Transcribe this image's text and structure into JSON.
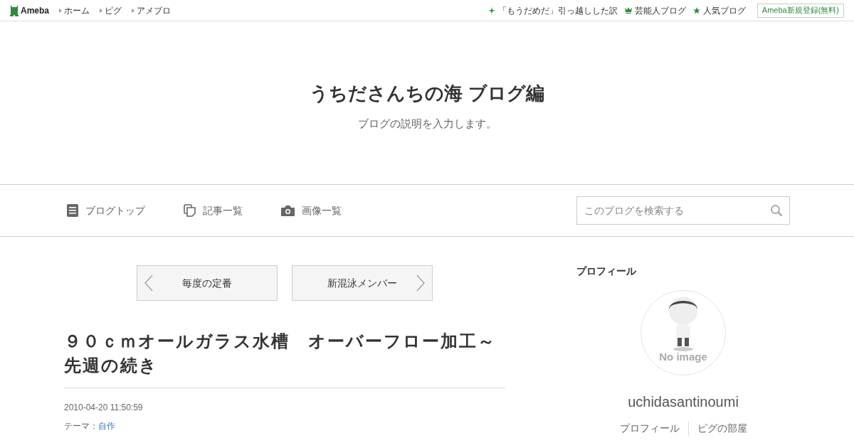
{
  "topbar": {
    "logo": "Ameba",
    "links": [
      "ホーム",
      "ピグ",
      "アメブロ"
    ],
    "right_links": [
      {
        "kind": "sparkle",
        "label": "「もうだめだ」引っ越しした訳"
      },
      {
        "kind": "crown",
        "label": "芸能人ブログ"
      },
      {
        "kind": "star",
        "label": "人気ブログ"
      }
    ],
    "signup": "Ameba新規登録(無料)"
  },
  "header": {
    "title": "うちださんちの海 ブログ編",
    "description": "ブログの説明を入力します。"
  },
  "nav": {
    "items": [
      {
        "kind": "document",
        "label": "ブログトップ"
      },
      {
        "kind": "copy",
        "label": "記事一覧"
      },
      {
        "kind": "camera",
        "label": "画像一覧"
      }
    ],
    "search": {
      "placeholder": "このブログを検索する"
    }
  },
  "pager": {
    "previous": "毎度の定番",
    "next": "新混泳メンバー"
  },
  "article": {
    "title": "９０ｃｍオールガラス水槽　オーバーフロー加工～先週の続き",
    "date": "2010-04-20 11:50:59",
    "theme_label": "テーマ：",
    "theme": "自作"
  },
  "sidebar": {
    "heading": "プロフィール",
    "avatar_caption": "No image",
    "username": "uchidasantinoumi",
    "links": [
      "プロフィール",
      "ピグの部屋"
    ]
  }
}
